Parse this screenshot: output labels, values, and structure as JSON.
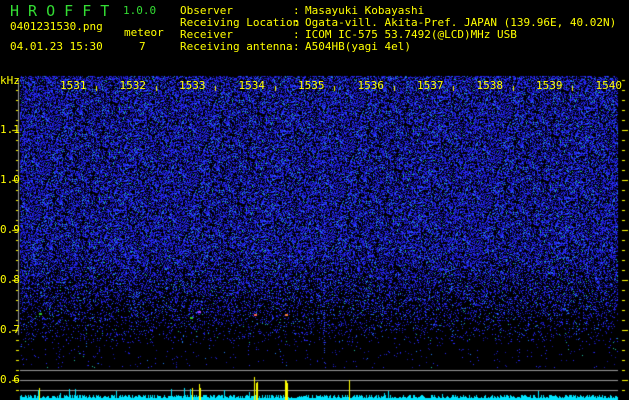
{
  "header": {
    "app_title": "H R O F F T",
    "version": "1.0.0",
    "filename": "0401231530.png",
    "datetime": "04.01.23 15:30",
    "meteor_label": "meteor",
    "meteor_count": "7"
  },
  "info": [
    {
      "label": "Observer",
      "value": "Masayuki Kobayashi"
    },
    {
      "label": "Receiving Location",
      "value": "Ogata-vill. Akita-Pref. JAPAN (139.96E, 40.02N)"
    },
    {
      "label": "Receiver",
      "value": "ICOM IC-575 53.7492(@LCD)MHz USB"
    },
    {
      "label": "Receiving antenna",
      "value": "A504HB(yagi 4el)"
    }
  ],
  "colors": {
    "text": "#ffff00",
    "title": "#33dd33",
    "noise": "#2020ff",
    "echo_bar": "#ffff00",
    "noise_bar": "#00e5ff",
    "grid": "#999999"
  },
  "chart_data": {
    "type": "heatmap",
    "ylabel": "kHz",
    "x_ticks": [
      "1531",
      "1532",
      "1533",
      "1534",
      "1535",
      "1536",
      "1537",
      "1538",
      "1539",
      "1540"
    ],
    "y_ticks": [
      "1.1",
      "1.0",
      "0.9",
      "0.8",
      "0.7",
      "0.6"
    ],
    "ylim": [
      0.56,
      1.2
    ],
    "meteor_echo_times": [
      "1533",
      "1534",
      "1534.8",
      "1535.4"
    ]
  }
}
